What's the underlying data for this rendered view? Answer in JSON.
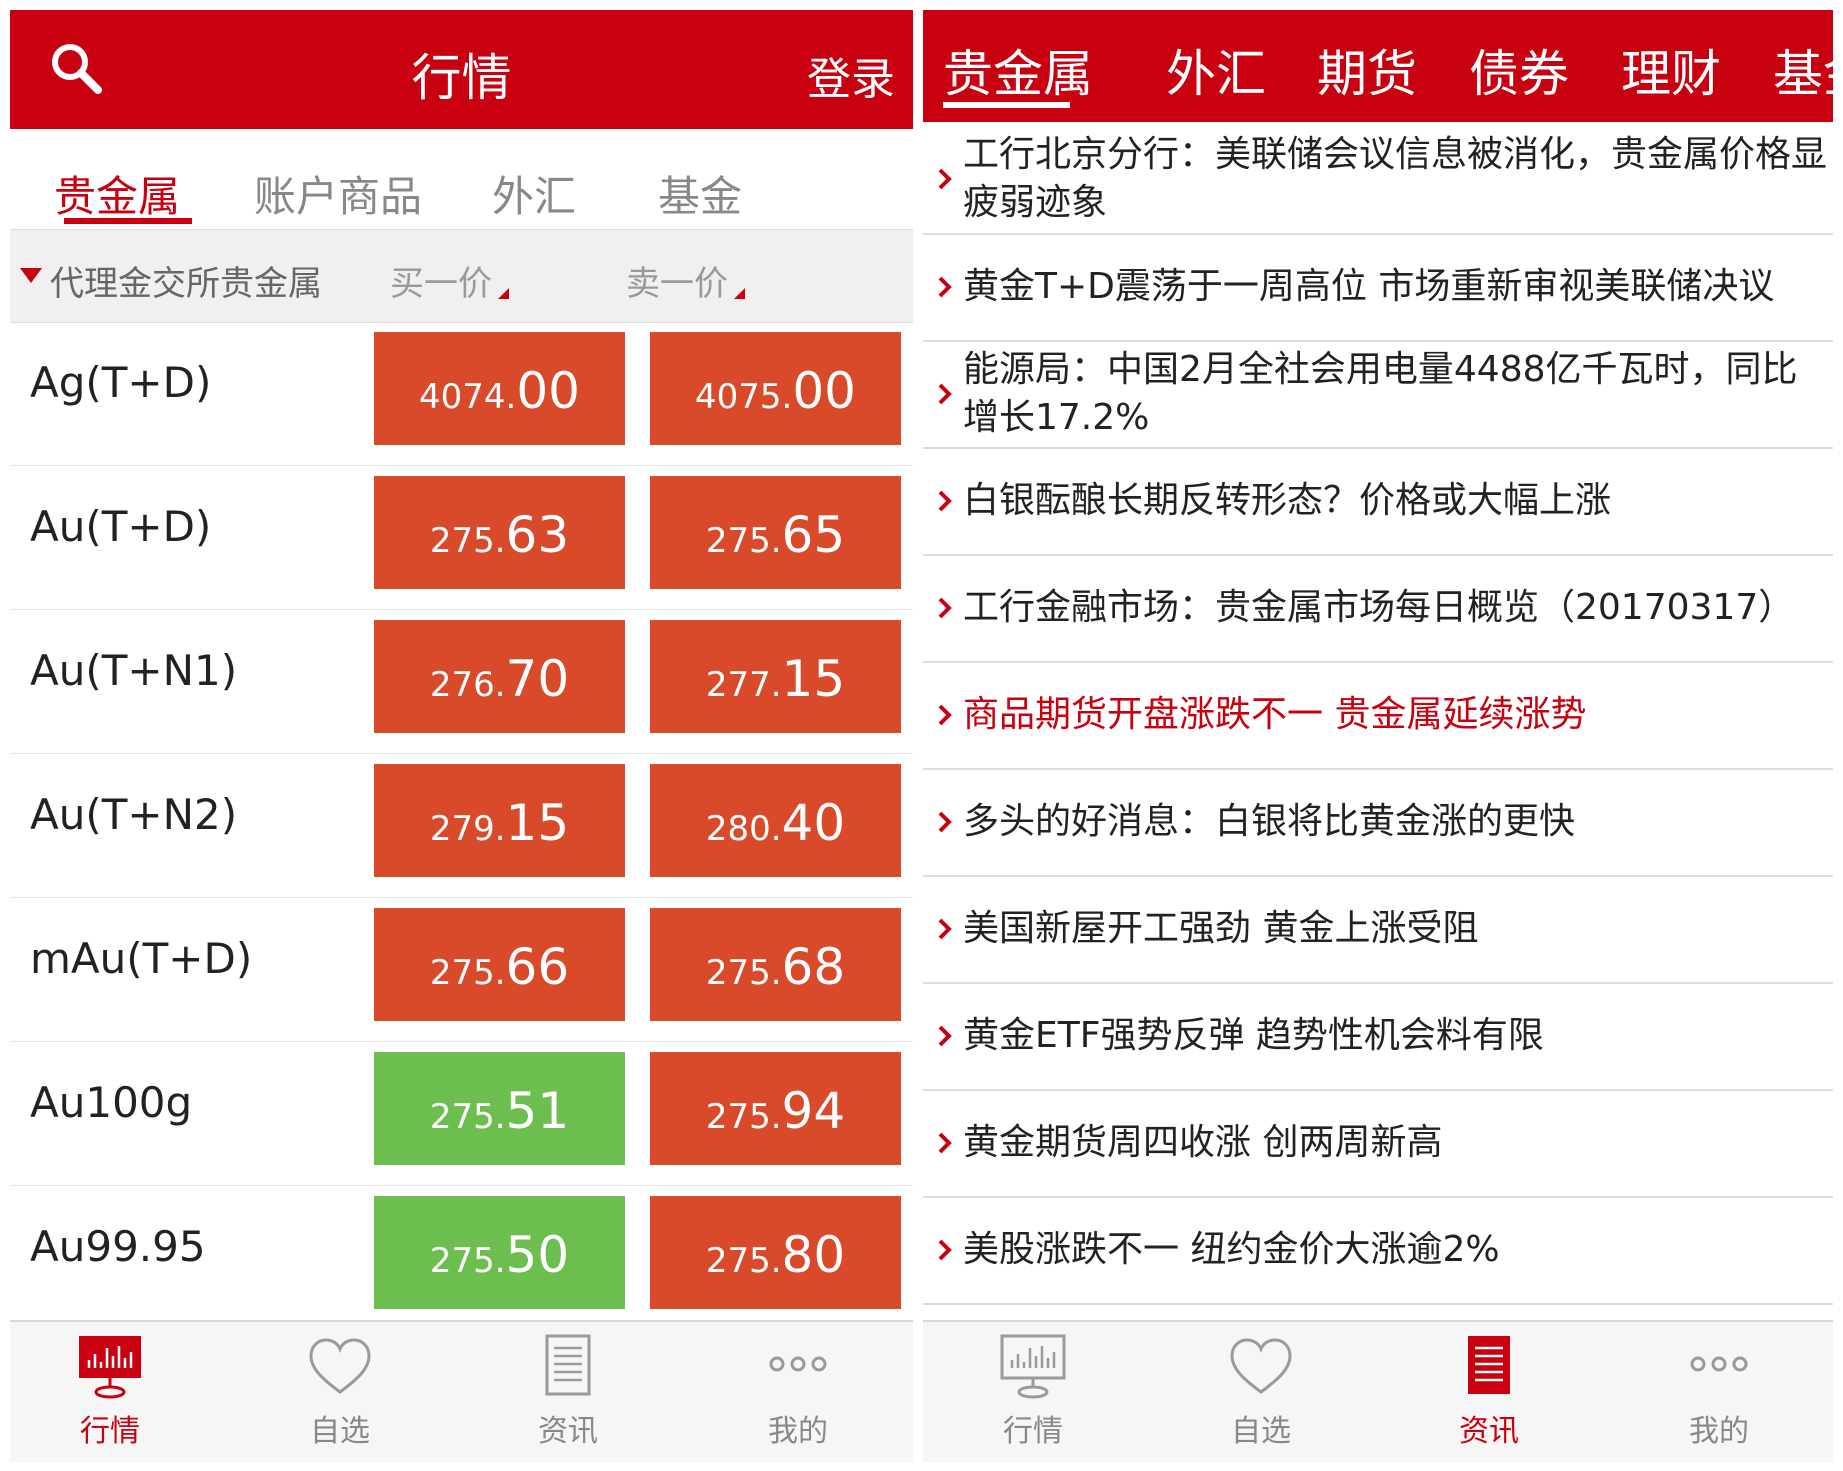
{
  "left": {
    "title": "行情",
    "login": "登录",
    "category_tabs": [
      "贵金属",
      "账户商品",
      "外汇",
      "基金"
    ],
    "list_header": {
      "label": "代理金交所贵金属",
      "bid": "买一价",
      "ask": "卖一价"
    },
    "rows": [
      {
        "name": "Ag(T+D)",
        "bid_int": "4074.",
        "bid_dec": "00",
        "ask_int": "4075.",
        "ask_dec": "00"
      },
      {
        "name": "Au(T+D)",
        "bid_int": "275.",
        "bid_dec": "63",
        "ask_int": "275.",
        "ask_dec": "65"
      },
      {
        "name": "Au(T+N1)",
        "bid_int": "276.",
        "bid_dec": "70",
        "ask_int": "277.",
        "ask_dec": "15"
      },
      {
        "name": "Au(T+N2)",
        "bid_int": "279.",
        "bid_dec": "15",
        "ask_int": "280.",
        "ask_dec": "40"
      },
      {
        "name": "mAu(T+D)",
        "bid_int": "275.",
        "bid_dec": "66",
        "ask_int": "275.",
        "ask_dec": "68"
      },
      {
        "name": "Au100g",
        "bid_int": "275.",
        "bid_dec": "51",
        "ask_int": "275.",
        "ask_dec": "94"
      },
      {
        "name": "Au99.95",
        "bid_int": "275.",
        "bid_dec": "50",
        "ask_int": "275.",
        "ask_dec": "80"
      }
    ],
    "nav": [
      "行情",
      "自选",
      "资讯",
      "我的"
    ]
  },
  "right": {
    "top_tabs": [
      "贵金属",
      "外汇",
      "期货",
      "债券",
      "理财",
      "基金"
    ],
    "news": [
      {
        "title": "工行北京分行：美联储会议信息被消化，贵金属价格显疲弱迹象"
      },
      {
        "title": "黄金T+D震荡于一周高位 市场重新审视美联储决议"
      },
      {
        "title": "能源局：中国2月全社会用电量4488亿千瓦时，同比增长17.2%"
      },
      {
        "title": "白银酝酿长期反转形态？价格或大幅上涨"
      },
      {
        "title": "工行金融市场：贵金属市场每日概览（20170317）"
      },
      {
        "title": "商品期货开盘涨跌不一 贵金属延续涨势"
      },
      {
        "title": "多头的好消息：白银将比黄金涨的更快"
      },
      {
        "title": "美国新屋开工强劲 黄金上涨受阻"
      },
      {
        "title": "黄金ETF强势反弹 趋势性机会料有限"
      },
      {
        "title": "黄金期货周四收涨 创两周新高"
      },
      {
        "title": "美股涨跌不一 纽约金价大涨逾2%"
      }
    ],
    "nav": [
      "行情",
      "自选",
      "资讯",
      "我的"
    ]
  },
  "colors": {
    "brand_red": "#c8000f",
    "price_up": "#d94a2b",
    "price_down": "#6cbf4f",
    "active_nav": "#c8000f"
  },
  "icons": {
    "left_nav": [
      "market-chart-icon",
      "heart-icon",
      "document-icon",
      "more-dots-icon"
    ],
    "right_nav": [
      "market-chart-icon",
      "heart-icon",
      "document-icon",
      "more-dots-icon"
    ]
  }
}
